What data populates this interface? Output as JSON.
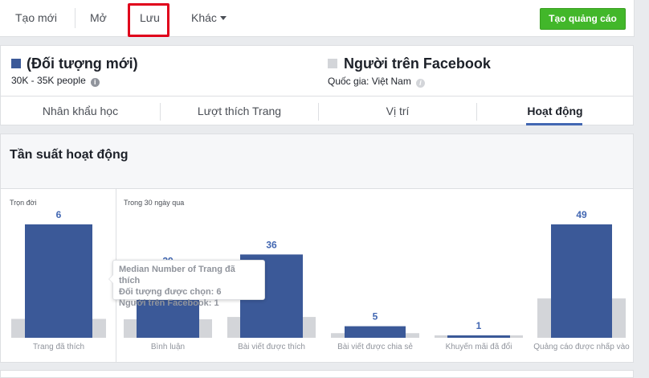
{
  "toolbar": {
    "new_label": "Tạo mới",
    "open_label": "Mở",
    "save_label": "Lưu",
    "more_label": "Khác",
    "create_ad_label": "Tạo quảng cáo"
  },
  "audience": {
    "selected": {
      "title": "(Đối tượng mới)",
      "size": "30K - 35K people",
      "color": "#3b5998"
    },
    "facebook": {
      "title": "Người trên Facebook",
      "country": "Quốc gia: Việt Nam",
      "color": "#d3d5d9"
    },
    "info_icon": "i"
  },
  "tabs": [
    {
      "label": "Nhân khẩu học"
    },
    {
      "label": "Lượt thích Trang"
    },
    {
      "label": "Vị trí"
    },
    {
      "label": "Hoạt động"
    }
  ],
  "active_tab": "Hoạt động",
  "section": {
    "title": "Tần suất hoạt động",
    "lifetime_label": "Trọn đời",
    "last30_label": "Trong 30 ngày qua"
  },
  "tooltip": {
    "line1": "Median Number of Trang đã thích",
    "line2": "Đối tượng được chọn: 6",
    "line3": "Người trên Facebook: 1"
  },
  "chart_data": {
    "type": "bar",
    "categories": [
      "Trang đã thích",
      "Bình luận",
      "Bài viết được thích",
      "Bài viết được chia sẻ",
      "Khuyến mãi đã đổi",
      "Quảng cáo được nhấp vào"
    ],
    "series": [
      {
        "name": "Đối tượng được chọn",
        "values": [
          6,
          29,
          36,
          5,
          1,
          49
        ],
        "color": "#3b5998"
      },
      {
        "name": "Người trên Facebook",
        "values": [
          1,
          8,
          9,
          2,
          1,
          17
        ],
        "color": "#d3d5d9"
      }
    ],
    "groups": [
      "Trọn đời",
      "Trong 30 ngày qua",
      "Trong 30 ngày qua",
      "Trong 30 ngày qua",
      "Trong 30 ngày qua",
      "Trong 30 ngày qua"
    ],
    "labeled_series": "Đối tượng được chọn"
  }
}
